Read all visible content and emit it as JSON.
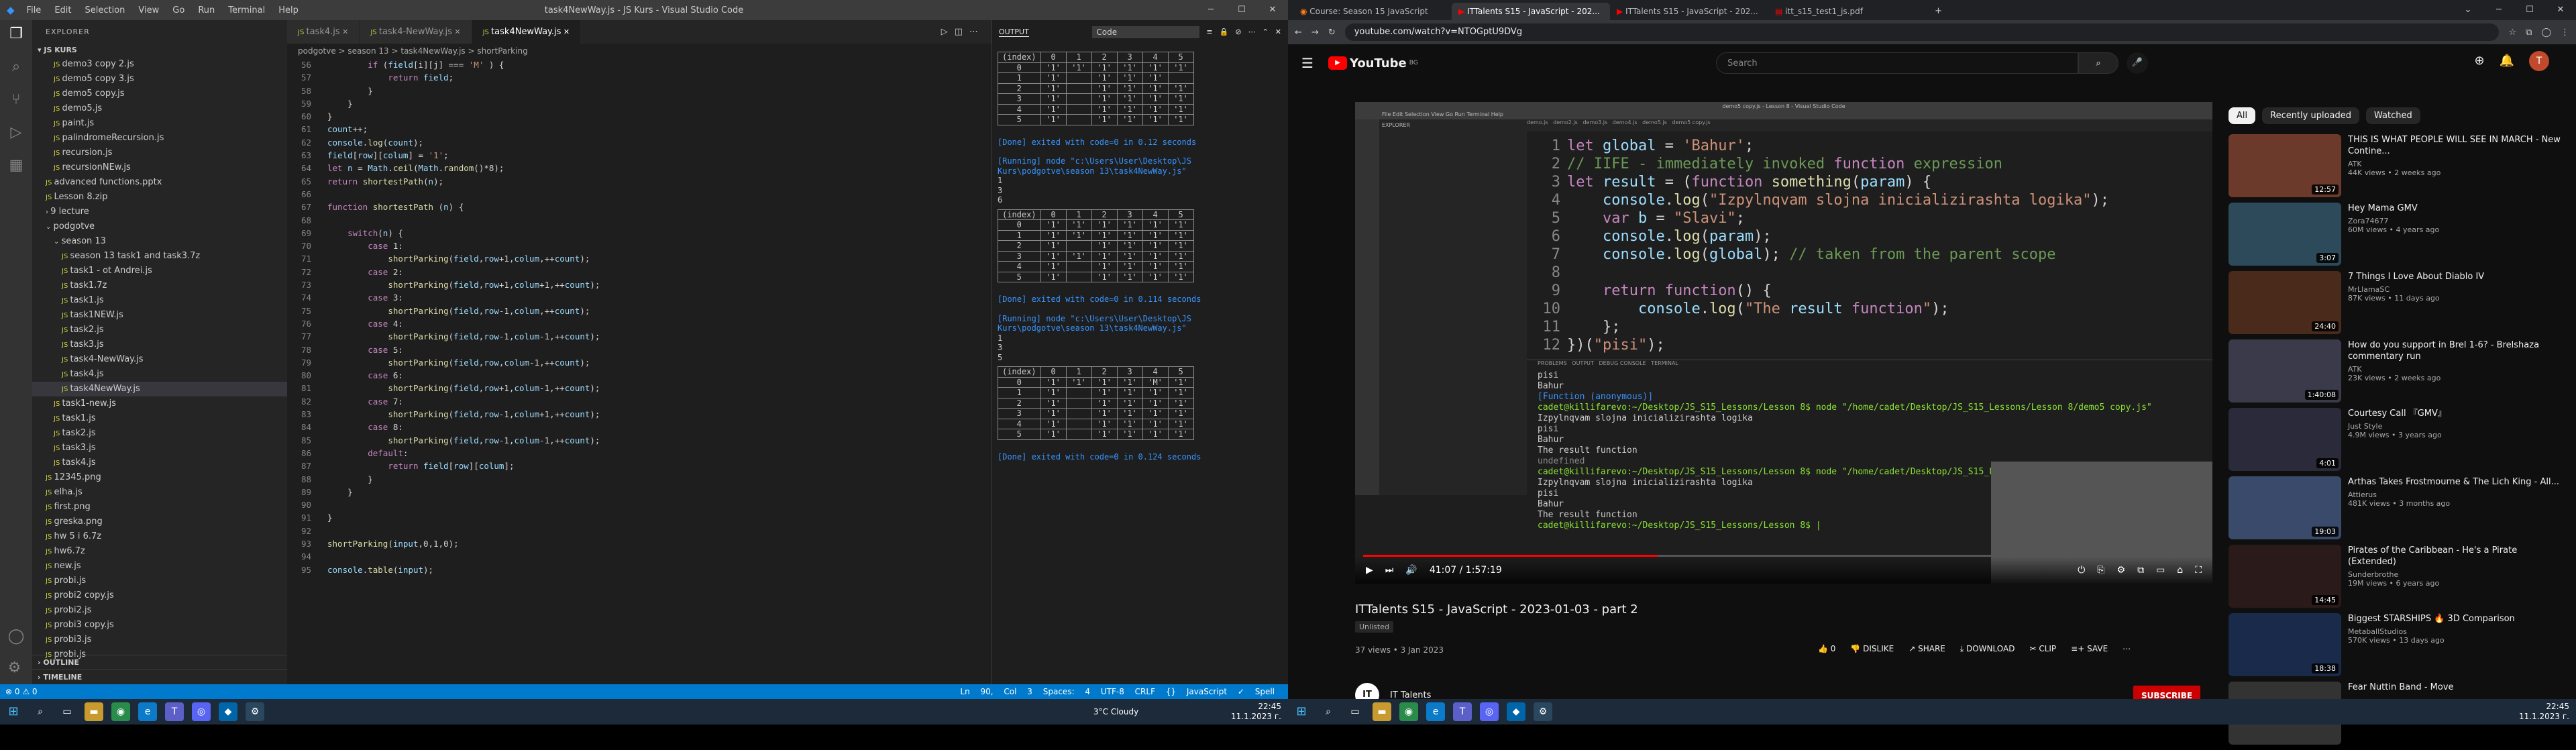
{
  "vscode": {
    "window_title": "task4NewWay.js - JS Kurs - Visual Studio Code",
    "menu": [
      "File",
      "Edit",
      "Selection",
      "View",
      "Go",
      "Run",
      "Terminal",
      "Help"
    ],
    "explorer_header": "EXPLORER",
    "workspace": "JS KURS",
    "tree": [
      {
        "label": "demo3 copy 2.js",
        "indent": 2,
        "type": "file"
      },
      {
        "label": "demo5 copy 3.js",
        "indent": 2,
        "type": "file"
      },
      {
        "label": "demo5 copy.js",
        "indent": 2,
        "type": "file"
      },
      {
        "label": "demo5.js",
        "indent": 2,
        "type": "file"
      },
      {
        "label": "paint.js",
        "indent": 2,
        "type": "file"
      },
      {
        "label": "palindromeRecursion.js",
        "indent": 2,
        "type": "file"
      },
      {
        "label": "recursion.js",
        "indent": 2,
        "type": "file"
      },
      {
        "label": "recursionNEw.js",
        "indent": 2,
        "type": "file"
      },
      {
        "label": "advanced functions.pptx",
        "indent": 1,
        "type": "file"
      },
      {
        "label": "Lesson 8.zip",
        "indent": 1,
        "type": "file"
      },
      {
        "label": "9 lecture",
        "indent": 1,
        "type": "folder"
      },
      {
        "label": "podgotve",
        "indent": 1,
        "type": "folder-open"
      },
      {
        "label": "season 13",
        "indent": 2,
        "type": "folder-open"
      },
      {
        "label": "season 13 task1 and task3.7z",
        "indent": 3,
        "type": "file"
      },
      {
        "label": "task1 - ot Andrei.js",
        "indent": 3,
        "type": "file"
      },
      {
        "label": "task1.7z",
        "indent": 3,
        "type": "file"
      },
      {
        "label": "task1.js",
        "indent": 3,
        "type": "file"
      },
      {
        "label": "task1NEW.js",
        "indent": 3,
        "type": "file"
      },
      {
        "label": "task2.js",
        "indent": 3,
        "type": "file"
      },
      {
        "label": "task3.js",
        "indent": 3,
        "type": "file"
      },
      {
        "label": "task4-NewWay.js",
        "indent": 3,
        "type": "file"
      },
      {
        "label": "task4.js",
        "indent": 3,
        "type": "file"
      },
      {
        "label": "task4NewWay.js",
        "indent": 3,
        "type": "file",
        "selected": true
      },
      {
        "label": "task1-new.js",
        "indent": 2,
        "type": "file"
      },
      {
        "label": "task1.js",
        "indent": 2,
        "type": "file"
      },
      {
        "label": "task2.js",
        "indent": 2,
        "type": "file"
      },
      {
        "label": "task3.js",
        "indent": 2,
        "type": "file"
      },
      {
        "label": "task4.js",
        "indent": 2,
        "type": "file"
      },
      {
        "label": "12345.png",
        "indent": 1,
        "type": "file"
      },
      {
        "label": "elha.js",
        "indent": 1,
        "type": "file"
      },
      {
        "label": "first.png",
        "indent": 1,
        "type": "file"
      },
      {
        "label": "greska.png",
        "indent": 1,
        "type": "file"
      },
      {
        "label": "hw 5 i 6.7z",
        "indent": 1,
        "type": "file"
      },
      {
        "label": "hw6.7z",
        "indent": 1,
        "type": "file"
      },
      {
        "label": "new.js",
        "indent": 1,
        "type": "file"
      },
      {
        "label": "probi.js",
        "indent": 1,
        "type": "file"
      },
      {
        "label": "probi2 copy.js",
        "indent": 1,
        "type": "file"
      },
      {
        "label": "probi2.js",
        "indent": 1,
        "type": "file"
      },
      {
        "label": "probi3 copy.js",
        "indent": 1,
        "type": "file"
      },
      {
        "label": "probi3.js",
        "indent": 1,
        "type": "file"
      },
      {
        "label": "probi.js",
        "indent": 1,
        "type": "file"
      }
    ],
    "outline": "OUTLINE",
    "timeline": "TIMELINE",
    "tabs": [
      "task4.js",
      "task4-NewWay.js",
      "task4NewWay.js"
    ],
    "active_tab": 2,
    "breadcrumb": "podgotve > season 13 > task4NewWay.js > shortParking",
    "code_lines": [
      {
        "n": "56",
        "t": "        if (field[i][j] === 'M' ) {"
      },
      {
        "n": "57",
        "t": "            return field;"
      },
      {
        "n": "58",
        "t": "        }"
      },
      {
        "n": "59",
        "t": "    }"
      },
      {
        "n": "60",
        "t": "}"
      },
      {
        "n": "61",
        "t": "count++;"
      },
      {
        "n": "62",
        "t": "console.log(count);"
      },
      {
        "n": "63",
        "t": "field[row][colum] = '1';"
      },
      {
        "n": "64",
        "t": "let n = Math.ceil(Math.random()*8);"
      },
      {
        "n": "65",
        "t": "return shortestPath(n);"
      },
      {
        "n": "66",
        "t": ""
      },
      {
        "n": "67",
        "t": "function shortestPath (n) {"
      },
      {
        "n": "68",
        "t": ""
      },
      {
        "n": "69",
        "t": "    switch(n) {"
      },
      {
        "n": "70",
        "t": "        case 1:"
      },
      {
        "n": "71",
        "t": "            shortParking(field,row+1,colum,++count);"
      },
      {
        "n": "72",
        "t": "        case 2:"
      },
      {
        "n": "73",
        "t": "            shortParking(field,row+1,colum+1,++count);"
      },
      {
        "n": "74",
        "t": "        case 3:"
      },
      {
        "n": "75",
        "t": "            shortParking(field,row-1,colum,++count);"
      },
      {
        "n": "76",
        "t": "        case 4:"
      },
      {
        "n": "77",
        "t": "            shortParking(field,row-1,colum-1,++count);"
      },
      {
        "n": "78",
        "t": "        case 5:"
      },
      {
        "n": "79",
        "t": "            shortParking(field,row,colum-1,++count);"
      },
      {
        "n": "80",
        "t": "        case 6:"
      },
      {
        "n": "81",
        "t": "            shortParking(field,row+1,colum-1,++count);"
      },
      {
        "n": "82",
        "t": "        case 7:"
      },
      {
        "n": "83",
        "t": "            shortParking(field,row-1,colum+1,++count);"
      },
      {
        "n": "84",
        "t": "        case 8:"
      },
      {
        "n": "85",
        "t": "            shortParking(field,row-1,colum-1,++count);"
      },
      {
        "n": "86",
        "t": "        default:"
      },
      {
        "n": "87",
        "t": "            return field[row][colum];"
      },
      {
        "n": "88",
        "t": "        }"
      },
      {
        "n": "89",
        "t": "    }"
      },
      {
        "n": "90",
        "t": ""
      },
      {
        "n": "91",
        "t": "}"
      },
      {
        "n": "92",
        "t": ""
      },
      {
        "n": "93",
        "t": "shortParking(input,0,1,0);"
      },
      {
        "n": "94",
        "t": ""
      },
      {
        "n": "95",
        "t": "console.table(input);"
      }
    ],
    "output_panel": {
      "title": "OUTPUT",
      "source": "Code",
      "table_header": [
        "(index)",
        "0",
        "1",
        "2",
        "3",
        "4",
        "5"
      ],
      "tables": [
        [
          [
            "0",
            "'1'",
            "'1'",
            "'1'",
            "'1'",
            "'1'",
            "'1'"
          ],
          [
            "1",
            "'1'",
            "",
            "'1'",
            "'1'",
            "'1'",
            ""
          ],
          [
            "2",
            "'1'",
            "",
            "'1'",
            "'1'",
            "'1'",
            "'1'"
          ],
          [
            "3",
            "'1'",
            "",
            "'1'",
            "'1'",
            "'1'",
            "'1'"
          ],
          [
            "4",
            "'1'",
            "",
            "'1'",
            "'1'",
            "'1'",
            "'1'"
          ],
          [
            "5",
            "'1'",
            "",
            "'1'",
            "'1'",
            "'1'",
            "'1'"
          ]
        ],
        [
          [
            "0",
            "'1'",
            "'1'",
            "'1'",
            "'1'",
            "'1'",
            "'1'"
          ],
          [
            "1",
            "'1'",
            "'1'",
            "'1'",
            "'1'",
            "'1'",
            "'1'"
          ],
          [
            "2",
            "'1'",
            "",
            "'1'",
            "'1'",
            "'1'",
            "'1'"
          ],
          [
            "3",
            "'1'",
            "'1'",
            "'1'",
            "'1'",
            "'1'",
            "'1'"
          ],
          [
            "4",
            "'1'",
            "",
            "'1'",
            "'1'",
            "'1'",
            "'1'"
          ],
          [
            "5",
            "'1'",
            "",
            "'1'",
            "'1'",
            "'1'",
            "'1'"
          ]
        ],
        [
          [
            "0",
            "'1'",
            "'1'",
            "'1'",
            "'1'",
            "'M'",
            "'1'"
          ],
          [
            "1",
            "'1'",
            "",
            "'1'",
            "'1'",
            "'1'",
            "'1'"
          ],
          [
            "2",
            "'1'",
            "",
            "'1'",
            "'1'",
            "'1'",
            "'1'"
          ],
          [
            "3",
            "'1'",
            "",
            "'1'",
            "'1'",
            "'1'",
            "'1'"
          ],
          [
            "4",
            "'1'",
            "",
            "'1'",
            "'1'",
            "'1'",
            "'1'"
          ],
          [
            "5",
            "'1'",
            "",
            "'1'",
            "'1'",
            "'1'",
            "'1'"
          ]
        ]
      ],
      "done1": "[Done] exited with code=0 in 0.12 seconds",
      "running1": "[Running] node \"c:\\Users\\User\\Desktop\\JS Kurs\\podgotve\\season 13\\task4NewWay.js\"",
      "nums1": [
        "1",
        "3",
        "6"
      ],
      "done2": "[Done] exited with code=0 in 0.114 seconds",
      "running2": "[Running] node \"c:\\Users\\User\\Desktop\\JS Kurs\\podgotve\\season 13\\task4NewWay.js\"",
      "nums2": [
        "1",
        "3",
        "5"
      ],
      "done3": "[Done] exited with code=0 in 0.124 seconds"
    },
    "status": {
      "left": "⊗ 0 ⚠ 0",
      "right": "Ln 90, Col 3   Spaces: 4   UTF-8   CRLF   {} JavaScript   ✓ Spell"
    }
  },
  "browser": {
    "tabs": [
      {
        "label": "Course: Season 15 JavaScript",
        "active": false
      },
      {
        "label": "ITTalents S15 - JavaScript - 202...",
        "active": true
      },
      {
        "label": "ITTalents S15 - JavaScript - 202...",
        "active": false
      },
      {
        "label": "itt_s15_test1_js.pdf",
        "active": false
      }
    ],
    "url": "youtube.com/watch?v=NTOGptU9DVg",
    "search_placeholder": "Search",
    "logo": "YouTube",
    "logo_country": "BG",
    "avatar_letter": "T",
    "video": {
      "title": "ITTalents S15 - JavaScript - 2023-01-03 - part 2",
      "badge": "Unlisted",
      "meta": "37 views  •  3 Jan 2023",
      "time": "41:07 / 1:57:19",
      "progress": 0.35,
      "channel": "IT Talents",
      "subscribe": "SUBSCRIBE",
      "actions": [
        "👍 0",
        "👎 DISLIKE",
        "↗ SHARE",
        "⤓ DOWNLOAD",
        "✂ CLIP",
        "≡+ SAVE",
        "⋯"
      ],
      "code_lines": [
        {
          "n": "1",
          "t": "let global = 'Bahur';"
        },
        {
          "n": "2",
          "t": "// IIFE - immediately invoked function expression"
        },
        {
          "n": "3",
          "t": "let result = (function something(param) {"
        },
        {
          "n": "4",
          "t": "    console.log(\"Izpylnqvam slojna inicializirashta logika\");"
        },
        {
          "n": "5",
          "t": "    var b = \"Slavi\";"
        },
        {
          "n": "6",
          "t": "    console.log(param);"
        },
        {
          "n": "7",
          "t": "    console.log(global); // taken from the parent scope"
        },
        {
          "n": "8",
          "t": ""
        },
        {
          "n": "9",
          "t": "    return function() {"
        },
        {
          "n": "10",
          "t": "        console.log(\"The result function\");"
        },
        {
          "n": "11",
          "t": "    };"
        },
        {
          "n": "12",
          "t": "})(\"pisi\");"
        }
      ],
      "terminal_lines": [
        "pisi",
        "Bahur",
        "[Function (anonymous)]",
        "cadet@killifarevo:~/Desktop/JS_S15_Lessons/Lesson 8$ node \"/home/cadet/Desktop/JS_S15_Lessons/Lesson 8/demo5 copy.js\"",
        "Izpylnqvam slojna inicializirashta logika",
        "pisi",
        "Bahur",
        "The result function",
        "undefined",
        "cadet@killifarevo:~/Desktop/JS_S15_Lessons/Lesson 8$ node \"/home/cadet/Desktop/JS_S15_Lessons/Lesson 8/demo5 copy.js\"",
        "Izpylnqvam slojna inicializirashta logika",
        "pisi",
        "Bahur",
        "The result function",
        "cadet@killifarevo:~/Desktop/JS_S15_Lessons/Lesson 8$ |"
      ]
    },
    "chips": [
      "All",
      "Recently uploaded",
      "Watched"
    ],
    "recommendations": [
      {
        "title": "THIS IS WHAT PEOPLE WILL SEE IN MARCH - New Contine...",
        "channel": "ATK",
        "meta": "44K views • 2 weeks ago",
        "dur": "12:57",
        "color": "#6b3a2a"
      },
      {
        "title": "Hey Mama GMV",
        "channel": "Zora74677",
        "meta": "60M views • 4 years ago",
        "dur": "3:07",
        "color": "#2d4a5a"
      },
      {
        "title": "7 Things I Love About Diablo IV",
        "channel": "MrLlamaSC",
        "meta": "87K views • 11 days ago",
        "dur": "24:40",
        "color": "#4a2a1a"
      },
      {
        "title": "How do you support in Brel 1-6? - Brelshaza commentary run",
        "channel": "ATK",
        "meta": "23K views • 2 weeks ago",
        "dur": "1:40:08",
        "color": "#3a3a4a"
      },
      {
        "title": "Courtesy Call 『GMV』",
        "channel": "Just Style",
        "meta": "4.9M views • 3 years ago",
        "dur": "4:01",
        "color": "#2a2a3a"
      },
      {
        "title": "Arthas Takes Frostmourne & The Lich King - All...",
        "channel": "Attierus",
        "meta": "481K views • 3 months ago",
        "dur": "19:03",
        "color": "#3a4a6a"
      },
      {
        "title": "Pirates of the Caribbean - He's a Pirate (Extended)",
        "channel": "Sunderbrothe",
        "meta": "19M views • 6 years ago",
        "dur": "14:45",
        "color": "#2a1a1a"
      },
      {
        "title": "Biggest STARSHIPS 🔥 3D Comparison",
        "channel": "MetaballStudios",
        "meta": "570K views • 13 days ago",
        "dur": "18:38",
        "color": "#1a2a4a"
      },
      {
        "title": "Fear Nuttin Band - Move",
        "channel": "",
        "meta": "",
        "dur": "",
        "color": "#333"
      }
    ]
  },
  "taskbar": {
    "weather": "3°C  Cloudy",
    "time": "22:45",
    "date": "11.1.2023 г."
  }
}
